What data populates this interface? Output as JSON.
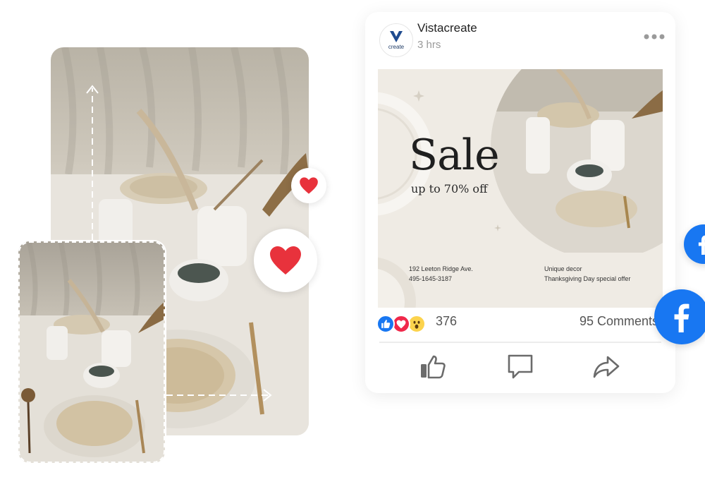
{
  "post": {
    "page_name": "Vistacreate",
    "avatar_label": "create",
    "time": "3 hrs",
    "more_icon": "more-horizontal-icon",
    "banner": {
      "title": "Sale",
      "subtitle": "up to 70% off",
      "address_line1": "192 Leeton Ridge Ave.",
      "address_line2": "495-1645-3187",
      "offer_line1": "Unique decor",
      "offer_line2": "Thanksgiving Day special offer"
    },
    "reactions": {
      "icons": [
        "like-reaction-icon",
        "love-reaction-icon",
        "wow-reaction-icon"
      ],
      "count": "376",
      "comments": "95 Comments"
    },
    "actions": [
      "like-icon",
      "comment-icon",
      "share-icon"
    ]
  },
  "decorations": {
    "hearts": [
      "heart-icon",
      "heart-icon"
    ],
    "facebook_badges": [
      "facebook-icon",
      "facebook-icon"
    ]
  },
  "colors": {
    "facebook_blue": "#1877f2",
    "heart_red": "#e8323c",
    "photo_tone": "#d9d4ca",
    "banner_bg": "#efebe4"
  }
}
